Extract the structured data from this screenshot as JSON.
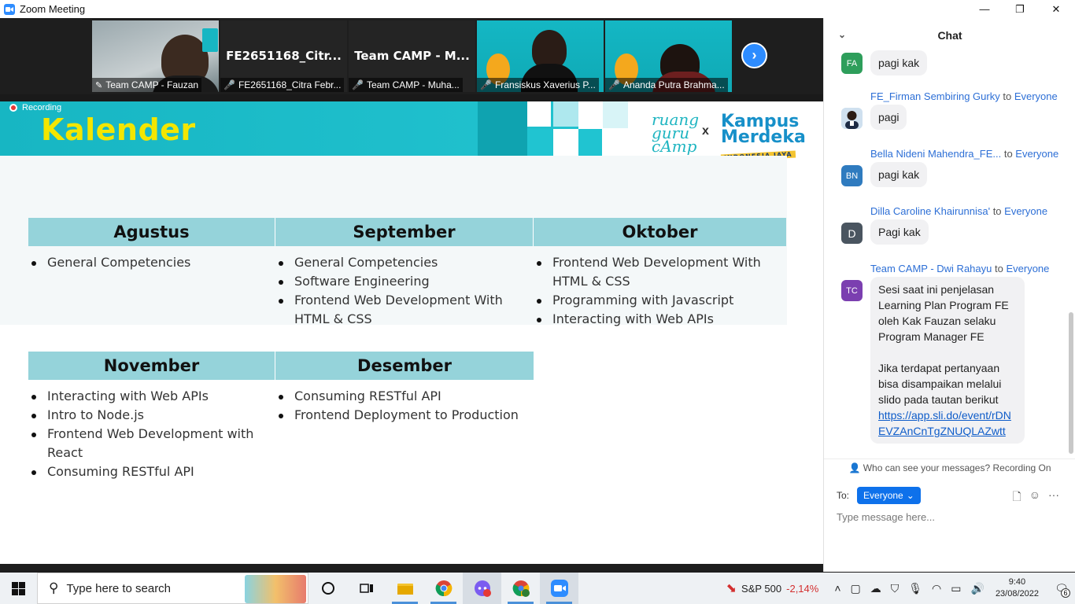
{
  "window": {
    "title": "Zoom Meeting",
    "minimize": "—",
    "restore": "❐",
    "close": "✕"
  },
  "videos": [
    {
      "name": "Team CAMP - Fauzan",
      "big": "",
      "type": "video",
      "pinned": true
    },
    {
      "name": "FE2651168_Citra Febr...",
      "big": "FE2651168_Citr...",
      "type": "name"
    },
    {
      "name": "Team CAMP - Muha...",
      "big": "Team CAMP - M...",
      "type": "name"
    },
    {
      "name": "Fransiskus Xaverius P...",
      "big": "",
      "type": "video"
    },
    {
      "name": "Ananda Putra Brahma...",
      "big": "",
      "type": "video"
    }
  ],
  "recording_label": "Recording",
  "slide": {
    "title": "Kalender",
    "logo_left": "ruang\nguru\ncAmp",
    "logo_x": "x",
    "logo_right": "Kampus\nMerdeka",
    "logo_tag": "INDONESIA JAYA",
    "months": [
      {
        "name": "Agustus",
        "items": [
          "General Competencies"
        ]
      },
      {
        "name": "September",
        "items": [
          "General Competencies",
          "Software Engineering",
          "Frontend Web Development With HTML & CSS"
        ]
      },
      {
        "name": "Oktober",
        "items": [
          "Frontend Web Development With HTML & CSS",
          "Programming with Javascript",
          "Interacting with Web APIs"
        ]
      },
      {
        "name": "November",
        "items": [
          "Interacting with Web APIs",
          "Intro to Node.js",
          "Frontend Web Development with React",
          "Consuming RESTful API"
        ]
      },
      {
        "name": "Desember",
        "items": [
          "Consuming RESTful API",
          "Frontend Deployment to Production"
        ]
      }
    ]
  },
  "chat": {
    "title": "Chat",
    "messages": [
      {
        "initials": "FA",
        "color": "#2e9e5b",
        "sender": "",
        "to": "",
        "recipient": "",
        "text": "pagi kak"
      },
      {
        "initials": "",
        "color": "#3a6fd8",
        "sender": "FE_Firman Sembiring Gurky",
        "to": "to",
        "recipient": "Everyone",
        "text": "pagi"
      },
      {
        "initials": "BN",
        "color": "#2f7bbf",
        "sender": "Bella Nideni Mahendra_FE...",
        "to": "to",
        "recipient": "Everyone",
        "text": "pagi kak"
      },
      {
        "initials": "D",
        "color": "#4a5560",
        "sender": "Dilla Caroline Khairunnisa'",
        "to": "to",
        "recipient": "Everyone",
        "text": "Pagi kak"
      },
      {
        "initials": "TC",
        "color": "#7b3fb0",
        "sender": "Team CAMP - Dwi Rahayu",
        "to": "to",
        "recipient": "Everyone",
        "text": "Sesi saat ini penjelasan Learning Plan Program FE oleh Kak Fauzan selaku Program Manager FE",
        "text2": "Jika terdapat pertanyaan bisa disampaikan melalui slido pada tautan berikut",
        "link": "https://app.sli.do/event/rDNEVZAnCnTgZNUQLAZwtt"
      }
    ],
    "who_can_see": "Who can see your messages? Recording On",
    "to_label": "To:",
    "to_value": "Everyone",
    "input_placeholder": "Type message here..."
  },
  "taskbar": {
    "search_placeholder": "Type here to search",
    "stock_name": "S&P 500",
    "stock_change": "-2,14%",
    "time": "9:40",
    "date": "23/08/2022",
    "notifications": "6"
  }
}
